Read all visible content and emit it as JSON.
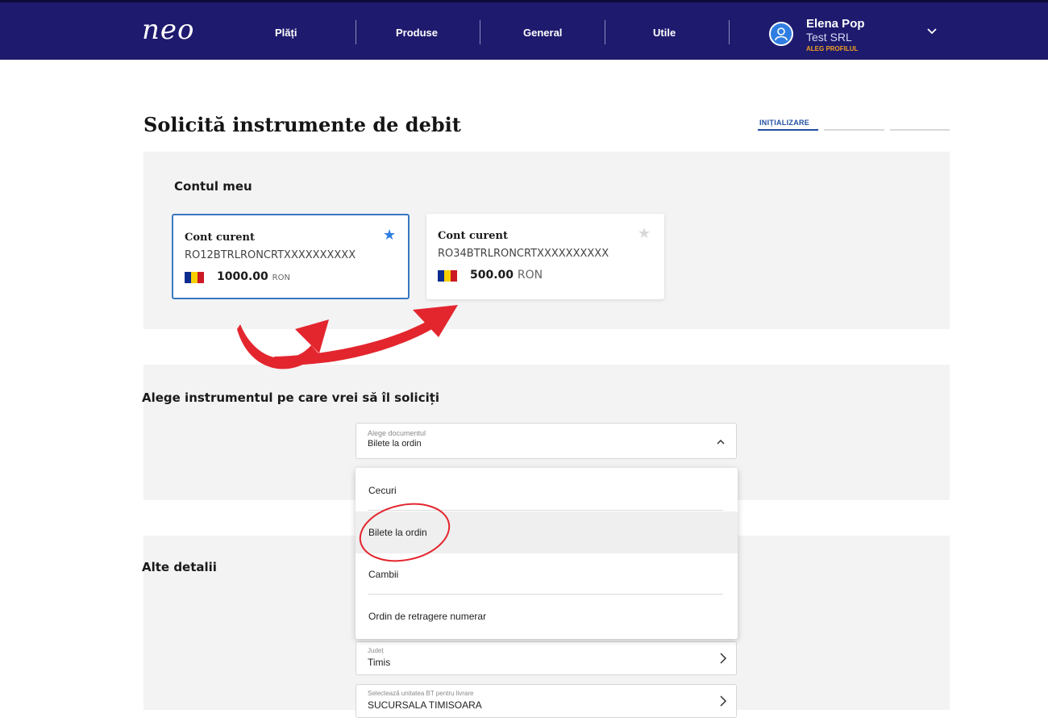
{
  "header": {
    "logo": "neo",
    "nav": [
      "Plăți",
      "Produse",
      "General",
      "Utile"
    ],
    "user": {
      "name": "Elena Pop",
      "company": "Test SRL",
      "profile_link": "ALEG PROFILUL"
    }
  },
  "page": {
    "title": "Solicită instrumente de debit",
    "step_label": "INIȚIALIZARE"
  },
  "accounts_section": {
    "title": "Contul meu",
    "accounts": [
      {
        "type": "Cont curent",
        "iban": "RO12BTRLRONCRTXXXXXXXXXX",
        "amount": "1000.00",
        "currency": "RON",
        "favorite": true,
        "selected": true
      },
      {
        "type": "Cont curent",
        "iban": "RO34BTRLRONCRTXXXXXXXXXX",
        "amount": "500.00",
        "currency": "RON",
        "favorite": false,
        "selected": false
      }
    ]
  },
  "instrument_section": {
    "title": "Alege instrumentul pe care vrei să îl soliciți",
    "select": {
      "label": "Alege documentul",
      "value": "Bilete la ordin",
      "options": [
        "Cecuri",
        "Bilete la ordin",
        "Cambii",
        "Ordin de retragere numerar"
      ]
    }
  },
  "details_section": {
    "title": "Alte detalii",
    "fields": [
      {
        "label": "Județ",
        "value": "Timis"
      },
      {
        "label": "Selectează unitatea BT pentru livrare",
        "value": "SUCURSALA TIMISOARA"
      }
    ]
  },
  "colors": {
    "header_bg": "#1e1a6e",
    "accent_blue": "#2f7de1",
    "annotation_red": "#e3262e",
    "section_bg": "#f3f3f3"
  }
}
